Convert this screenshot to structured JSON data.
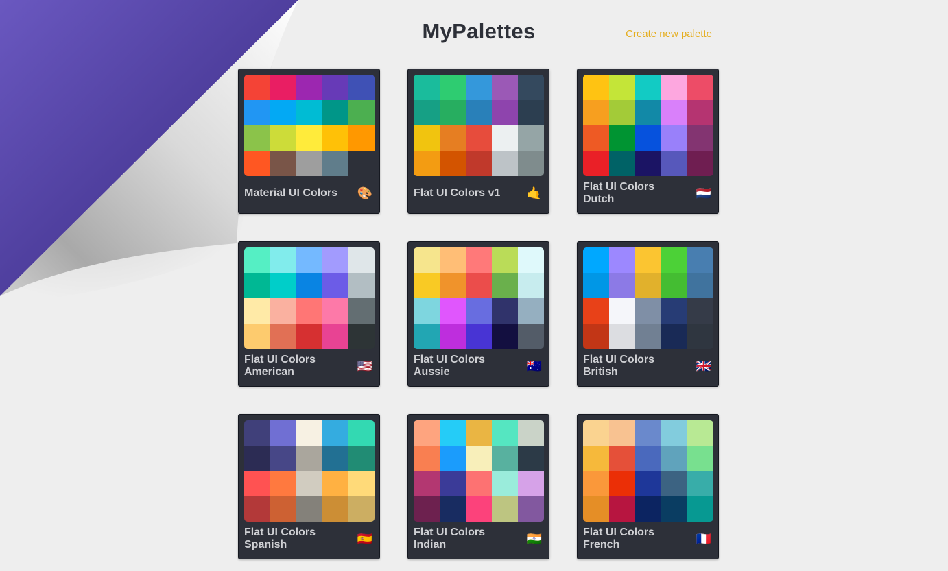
{
  "header": {
    "title": "MyPalettes",
    "create_link": "Create new palette"
  },
  "palettes": [
    {
      "name": "Material UI Colors",
      "emoji": "🎨",
      "colors": [
        "#f44336",
        "#e91e63",
        "#9c27b0",
        "#673ab7",
        "#3f51b5",
        "#2196f3",
        "#03a9f4",
        "#00bcd4",
        "#009688",
        "#4caf50",
        "#8bc34a",
        "#cddc39",
        "#ffeb3b",
        "#ffc107",
        "#ff9800",
        "#ff5722",
        "#795548",
        "#9e9e9e",
        "#607d8b",
        "#2d3039"
      ]
    },
    {
      "name": "Flat UI Colors v1",
      "emoji": "🤙",
      "colors": [
        "#1abc9c",
        "#2ecc71",
        "#3498db",
        "#9b59b6",
        "#34495e",
        "#16a085",
        "#27ae60",
        "#2980b9",
        "#8e44ad",
        "#2c3e50",
        "#f1c40f",
        "#e67e22",
        "#e74c3c",
        "#ecf0f1",
        "#95a5a6",
        "#f39c12",
        "#d35400",
        "#c0392b",
        "#bdc3c7",
        "#7f8c8d"
      ]
    },
    {
      "name": "Flat UI Colors Dutch",
      "emoji": "🇳🇱",
      "colors": [
        "#ffc312",
        "#c4e538",
        "#12cbc4",
        "#fda7df",
        "#ed4c67",
        "#f79f1f",
        "#a3cb38",
        "#1289a7",
        "#d980fa",
        "#b53471",
        "#ee5a24",
        "#009432",
        "#0652dd",
        "#9980fa",
        "#833471",
        "#ea2027",
        "#006266",
        "#1b1464",
        "#5758bb",
        "#6f1e51"
      ]
    },
    {
      "name": "Flat UI Colors American",
      "emoji": "🇺🇸",
      "colors": [
        "#55efc4",
        "#81ecec",
        "#74b9ff",
        "#a29bfe",
        "#dfe6e9",
        "#00b894",
        "#00cec9",
        "#0984e3",
        "#6c5ce7",
        "#b2bec3",
        "#ffeaa7",
        "#fab1a0",
        "#ff7675",
        "#fd79a8",
        "#636e72",
        "#fdcb6e",
        "#e17055",
        "#d63031",
        "#e84393",
        "#2d3436"
      ]
    },
    {
      "name": "Flat UI Colors Aussie",
      "emoji": "🇦🇺",
      "colors": [
        "#f6e58d",
        "#ffbe76",
        "#ff7979",
        "#badc58",
        "#dff9fb",
        "#f9ca24",
        "#f0932b",
        "#eb4d4b",
        "#6ab04c",
        "#c7ecee",
        "#7ed6df",
        "#e056fd",
        "#686de0",
        "#30336b",
        "#95afc0",
        "#22a6b3",
        "#be2edd",
        "#4834d4",
        "#130f40",
        "#535c68"
      ]
    },
    {
      "name": "Flat UI Colors British",
      "emoji": "🇬🇧",
      "colors": [
        "#00a8ff",
        "#9c88ff",
        "#fbc531",
        "#4cd137",
        "#487eb0",
        "#0097e6",
        "#8c7ae6",
        "#e1b12c",
        "#44bd32",
        "#40739e",
        "#e84118",
        "#f5f6fa",
        "#7f8fa6",
        "#273c75",
        "#353b48",
        "#c23616",
        "#dcdde1",
        "#718093",
        "#192a56",
        "#2f3640"
      ]
    },
    {
      "name": "Flat UI Colors Spanish",
      "emoji": "🇪🇸",
      "colors": [
        "#40407a",
        "#706fd3",
        "#f7f1e3",
        "#34ace0",
        "#33d9b2",
        "#2c2c54",
        "#474787",
        "#aaa69d",
        "#227093",
        "#218c74",
        "#ff5252",
        "#ff793f",
        "#d1ccc0",
        "#ffb142",
        "#ffda79",
        "#b33939",
        "#cd6133",
        "#84817a",
        "#cc8e35",
        "#ccae62"
      ]
    },
    {
      "name": "Flat UI Colors Indian",
      "emoji": "🇮🇳",
      "colors": [
        "#fea47f",
        "#25ccf7",
        "#eab543",
        "#55e6c1",
        "#cad3c8",
        "#f97f51",
        "#1b9cfc",
        "#f8efba",
        "#58b19f",
        "#2c3a47",
        "#b33771",
        "#3b3b98",
        "#fd7272",
        "#9aecdb",
        "#d6a2e8",
        "#6d214f",
        "#182c61",
        "#fc427b",
        "#bdc581",
        "#82589f"
      ]
    },
    {
      "name": "Flat UI Colors French",
      "emoji": "🇫🇷",
      "colors": [
        "#fad390",
        "#f8c291",
        "#6a89cc",
        "#82ccdd",
        "#b8e994",
        "#f6b93b",
        "#e55039",
        "#4a69bd",
        "#60a3bc",
        "#78e08f",
        "#fa983a",
        "#eb2f06",
        "#1e3799",
        "#3c6382",
        "#38ada9",
        "#e58e26",
        "#b71540",
        "#0c2461",
        "#0a3d62",
        "#079992"
      ]
    }
  ]
}
